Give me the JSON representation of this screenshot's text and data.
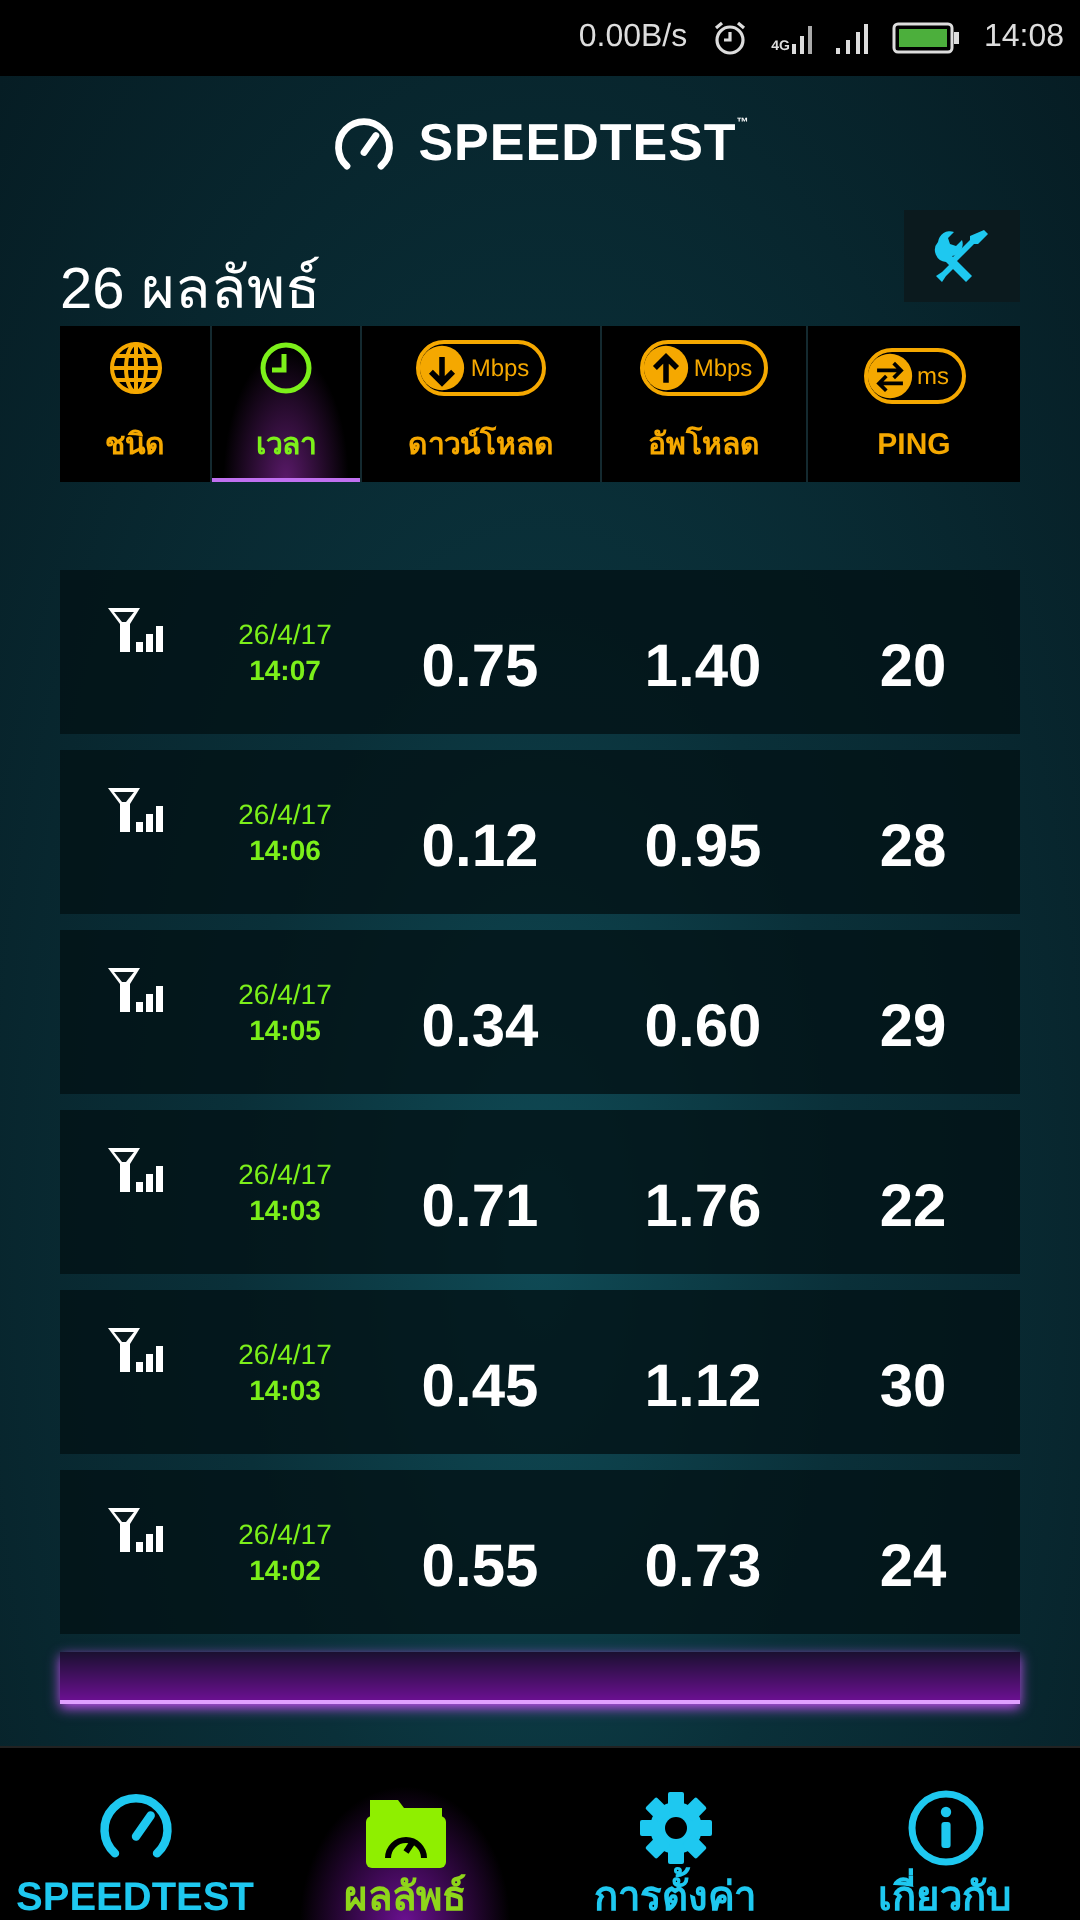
{
  "status_bar": {
    "speed": "0.00B/s",
    "network": "4G",
    "time": "14:08"
  },
  "app_bar": {
    "title": "SPEEDTEST",
    "trademark": "™"
  },
  "results": {
    "count_label": "26 ผลลัพธ์"
  },
  "columns": [
    {
      "kind": "type",
      "label": "ชนิด",
      "selected": false
    },
    {
      "kind": "time",
      "label": "เวลา",
      "selected": true
    },
    {
      "kind": "download",
      "label": "ดาวน์โหลด",
      "unit": "Mbps",
      "selected": false
    },
    {
      "kind": "upload",
      "label": "อัพโหลด",
      "unit": "Mbps",
      "selected": false
    },
    {
      "kind": "ping",
      "label": "PING",
      "unit": "ms",
      "selected": false
    }
  ],
  "rows": [
    {
      "date": "26/4/17",
      "time": "14:07",
      "download": "0.75",
      "upload": "1.40",
      "ping": "20"
    },
    {
      "date": "26/4/17",
      "time": "14:06",
      "download": "0.12",
      "upload": "0.95",
      "ping": "28"
    },
    {
      "date": "26/4/17",
      "time": "14:05",
      "download": "0.34",
      "upload": "0.60",
      "ping": "29"
    },
    {
      "date": "26/4/17",
      "time": "14:03",
      "download": "0.71",
      "upload": "1.76",
      "ping": "22"
    },
    {
      "date": "26/4/17",
      "time": "14:03",
      "download": "0.45",
      "upload": "1.12",
      "ping": "30"
    },
    {
      "date": "26/4/17",
      "time": "14:02",
      "download": "0.55",
      "upload": "0.73",
      "ping": "24"
    }
  ],
  "nav": [
    {
      "kind": "speedtest",
      "label": "SPEEDTEST",
      "selected": false
    },
    {
      "kind": "results",
      "label": "ผลลัพธ์",
      "selected": true
    },
    {
      "kind": "settings",
      "label": "การตั้งค่า",
      "selected": false
    },
    {
      "kind": "about",
      "label": "เกี่ยวกับ",
      "selected": false
    }
  ]
}
